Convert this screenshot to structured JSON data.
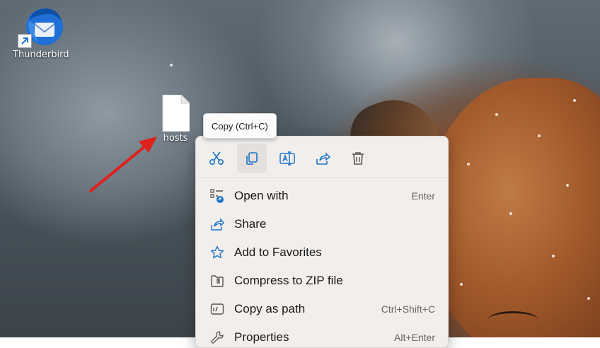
{
  "desktop": {
    "icons": [
      {
        "label": "Thunderbird"
      },
      {
        "label": "hosts"
      }
    ]
  },
  "tooltip": {
    "text": "Copy (Ctrl+C)"
  },
  "context_menu": {
    "toolbar": [
      {
        "icon": "scissors-icon",
        "action": "cut"
      },
      {
        "icon": "copy-icon",
        "action": "copy"
      },
      {
        "icon": "rename-icon",
        "action": "rename"
      },
      {
        "icon": "share-icon",
        "action": "share"
      },
      {
        "icon": "trash-icon",
        "action": "delete"
      }
    ],
    "items": [
      {
        "label": "Open with",
        "shortcut": "Enter",
        "icon": "open-with-icon"
      },
      {
        "label": "Share",
        "shortcut": "",
        "icon": "share-icon"
      },
      {
        "label": "Add to Favorites",
        "shortcut": "",
        "icon": "star-icon"
      },
      {
        "label": "Compress to ZIP file",
        "shortcut": "",
        "icon": "zip-icon"
      },
      {
        "label": "Copy as path",
        "shortcut": "Ctrl+Shift+C",
        "icon": "copy-path-icon"
      },
      {
        "label": "Properties",
        "shortcut": "Alt+Enter",
        "icon": "wrench-icon"
      }
    ]
  },
  "colors": {
    "accent": "#1a73c9",
    "arrow": "#e0201b"
  }
}
